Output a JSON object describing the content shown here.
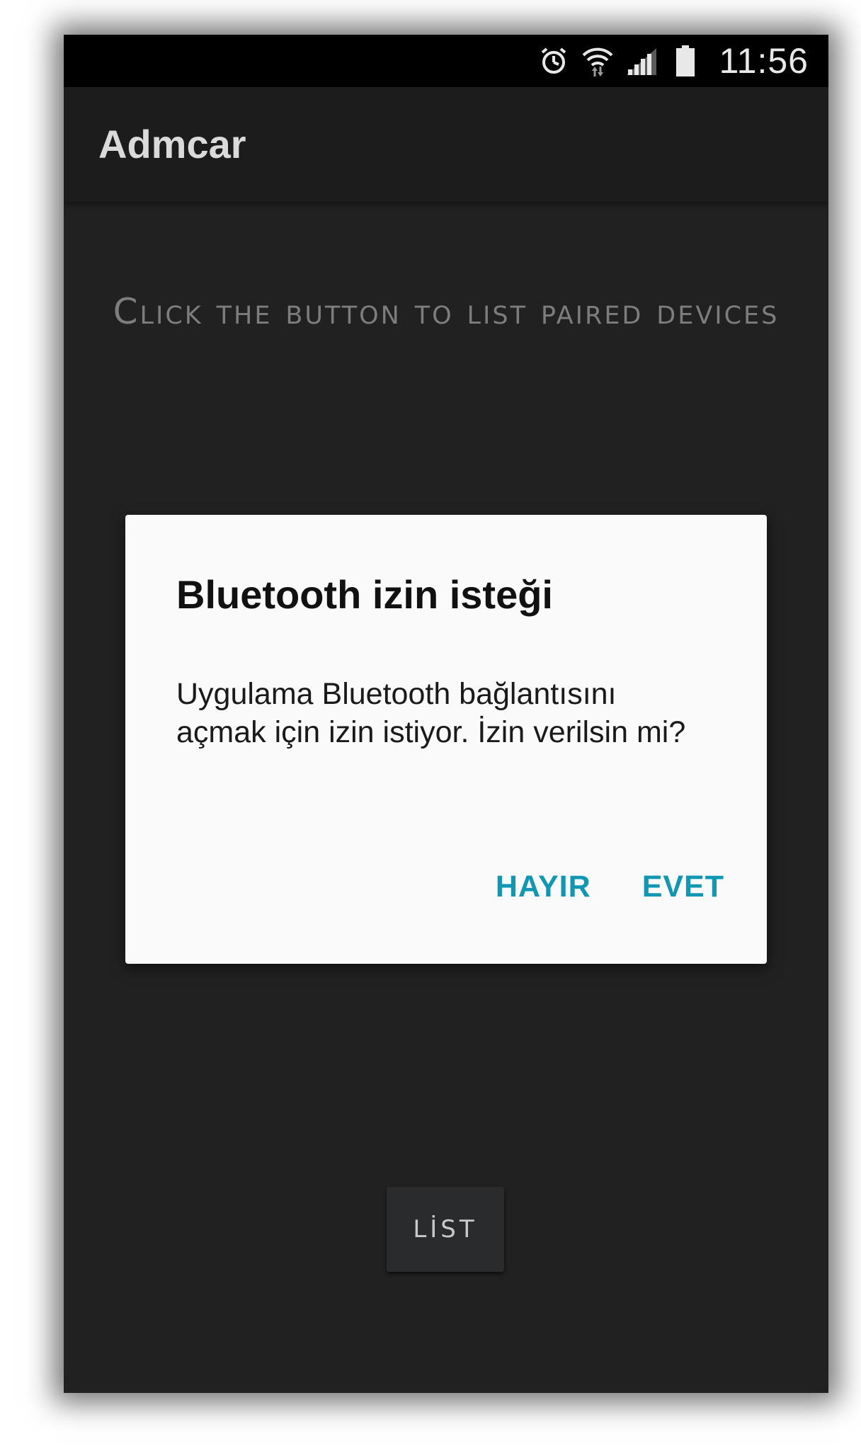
{
  "status_bar": {
    "icons": [
      "alarm-icon",
      "wifi-icon",
      "signal-icon",
      "battery-icon"
    ],
    "time": "11:56"
  },
  "app_bar": {
    "title": "Admcar"
  },
  "main": {
    "instruction": "Click the button to list paired devices",
    "list_button_label": "LİST"
  },
  "dialog": {
    "title": "Bluetooth izin isteği",
    "message": "Uygulama Bluetooth bağlantısını açmak için izin istiyor. İzin verilsin mi?",
    "negative_label": "HAYIR",
    "positive_label": "EVET"
  },
  "colors": {
    "accent": "#0f97b4",
    "background": "#212121",
    "app_bar": "#1c1c1c",
    "status_bar": "#000000",
    "dialog": "#fafafa"
  }
}
